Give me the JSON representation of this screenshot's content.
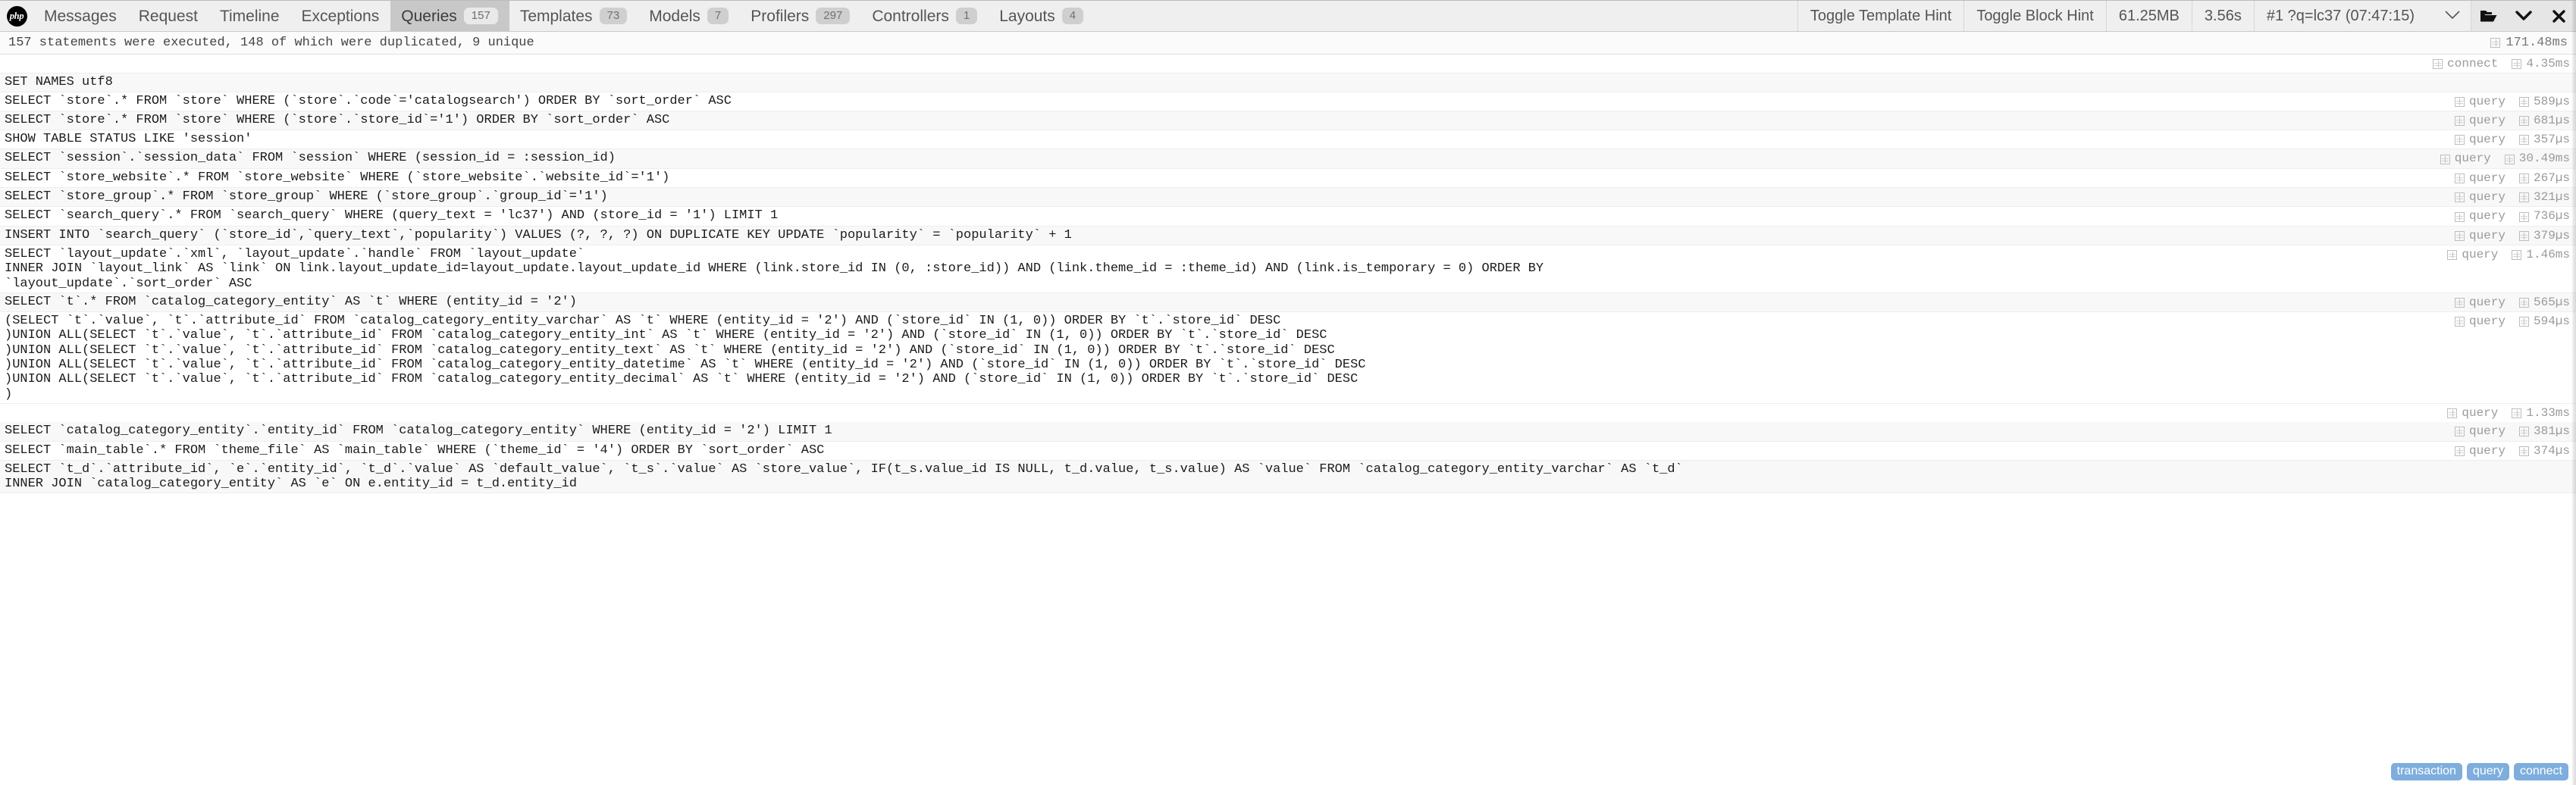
{
  "header": {
    "logo": "php-logo",
    "tabs": [
      {
        "label": "Messages",
        "badge": null,
        "active": false,
        "name": "tab-messages"
      },
      {
        "label": "Request",
        "badge": null,
        "active": false,
        "name": "tab-request"
      },
      {
        "label": "Timeline",
        "badge": null,
        "active": false,
        "name": "tab-timeline"
      },
      {
        "label": "Exceptions",
        "badge": null,
        "active": false,
        "name": "tab-exceptions"
      },
      {
        "label": "Queries",
        "badge": "157",
        "active": true,
        "name": "tab-queries"
      },
      {
        "label": "Templates",
        "badge": "73",
        "active": false,
        "name": "tab-templates"
      },
      {
        "label": "Models",
        "badge": "7",
        "active": false,
        "name": "tab-models"
      },
      {
        "label": "Profilers",
        "badge": "297",
        "active": false,
        "name": "tab-profilers"
      },
      {
        "label": "Controllers",
        "badge": "1",
        "active": false,
        "name": "tab-controllers"
      },
      {
        "label": "Layouts",
        "badge": "4",
        "active": false,
        "name": "tab-layouts"
      }
    ],
    "toggle_template_hint": "Toggle Template Hint",
    "toggle_block_hint": "Toggle Block Hint",
    "memory": "61.25MB",
    "time": "3.56s",
    "dataset": "#1 ?q=lc37 (07:47:15)",
    "controls": {
      "open_icon": "open-folder-icon",
      "minimize_icon": "chevron-down-icon",
      "close_icon": "close-icon",
      "dataset_chevron": "chevron-down-icon"
    }
  },
  "summary": {
    "text": "157 statements were executed, 148 of which were duplicated, 9 unique",
    "total_time": "171.48ms",
    "total_time_icon": "duration-icon"
  },
  "queries": [
    {
      "sql": "SET NAMES utf8",
      "type": "",
      "duration": "",
      "has_meta": false
    },
    {
      "sql": "SELECT `store`.* FROM `store` WHERE (`store`.`code`='catalogsearch') ORDER BY `sort_order` ASC",
      "type": "query",
      "duration": "589µs",
      "has_meta": true
    },
    {
      "sql": "SELECT `store`.* FROM `store` WHERE (`store`.`store_id`='1') ORDER BY `sort_order` ASC",
      "type": "query",
      "duration": "681µs",
      "has_meta": true
    },
    {
      "sql": "SHOW TABLE STATUS LIKE 'session'",
      "type": "query",
      "duration": "357µs",
      "has_meta": true
    },
    {
      "sql": "SELECT `session`.`session_data` FROM `session` WHERE (session_id = :session_id)",
      "type": "query",
      "duration": "30.49ms",
      "has_meta": true
    },
    {
      "sql": "SELECT `store_website`.* FROM `store_website` WHERE (`store_website`.`website_id`='1')",
      "type": "query",
      "duration": "267µs",
      "has_meta": true
    },
    {
      "sql": "SELECT `store_group`.* FROM `store_group` WHERE (`store_group`.`group_id`='1')",
      "type": "query",
      "duration": "321µs",
      "has_meta": true
    },
    {
      "sql": "SELECT `search_query`.* FROM `search_query` WHERE (query_text = 'lc37') AND (store_id = '1') LIMIT 1",
      "type": "query",
      "duration": "736µs",
      "has_meta": true
    },
    {
      "sql": "INSERT INTO `search_query` (`store_id`,`query_text`,`popularity`) VALUES (?, ?, ?) ON DUPLICATE KEY UPDATE `popularity` = `popularity` + 1",
      "type": "query",
      "duration": "379µs",
      "has_meta": true
    },
    {
      "sql": "SELECT `layout_update`.`xml`, `layout_update`.`handle` FROM `layout_update`\nINNER JOIN `layout_link` AS `link` ON link.layout_update_id=layout_update.layout_update_id WHERE (link.store_id IN (0, :store_id)) AND (link.theme_id = :theme_id) AND (link.is_temporary = 0) ORDER BY\n`layout_update`.`sort_order` ASC",
      "type": "query",
      "duration": "1.46ms",
      "has_meta": true
    },
    {
      "sql": "SELECT `t`.* FROM `catalog_category_entity` AS `t` WHERE (entity_id = '2')",
      "type": "query",
      "duration": "565µs",
      "has_meta": true
    },
    {
      "sql": "(SELECT `t`.`value`, `t`.`attribute_id` FROM `catalog_category_entity_varchar` AS `t` WHERE (entity_id = '2') AND (`store_id` IN (1, 0)) ORDER BY `t`.`store_id` DESC\n)UNION ALL(SELECT `t`.`value`, `t`.`attribute_id` FROM `catalog_category_entity_int` AS `t` WHERE (entity_id = '2') AND (`store_id` IN (1, 0)) ORDER BY `t`.`store_id` DESC\n)UNION ALL(SELECT `t`.`value`, `t`.`attribute_id` FROM `catalog_category_entity_text` AS `t` WHERE (entity_id = '2') AND (`store_id` IN (1, 0)) ORDER BY `t`.`store_id` DESC\n)UNION ALL(SELECT `t`.`value`, `t`.`attribute_id` FROM `catalog_category_entity_datetime` AS `t` WHERE (entity_id = '2') AND (`store_id` IN (1, 0)) ORDER BY `t`.`store_id` DESC\n)UNION ALL(SELECT `t`.`value`, `t`.`attribute_id` FROM `catalog_category_entity_decimal` AS `t` WHERE (entity_id = '2') AND (`store_id` IN (1, 0)) ORDER BY `t`.`store_id` DESC\n)",
      "type": "query",
      "duration": "594µs",
      "has_meta": true,
      "meta_bottom": true,
      "meta_extra": "1.33ms"
    },
    {
      "sql": "SELECT `catalog_category_entity`.`entity_id` FROM `catalog_category_entity` WHERE (entity_id = '2') LIMIT 1",
      "type": "query",
      "duration": "381µs",
      "has_meta": true
    },
    {
      "sql": "SELECT `main_table`.* FROM `theme_file` AS `main_table` WHERE (`theme_id` = '4') ORDER BY `sort_order` ASC",
      "type": "query",
      "duration": "374µs",
      "has_meta": true
    },
    {
      "sql": "SELECT `t_d`.`attribute_id`, `e`.`entity_id`, `t_d`.`value` AS `default_value`, `t_s`.`value` AS `store_value`, IF(t_s.value_id IS NULL, t_d.value, t_s.value) AS `value` FROM `catalog_category_entity_varchar` AS `t_d`\nINNER JOIN `catalog_category_entity` AS `e` ON e.entity_id = t_d.entity_id",
      "type": "query",
      "duration": "",
      "has_meta": false
    }
  ],
  "connect_row": {
    "type": "connect",
    "duration": "4.35ms"
  },
  "footer_badges": [
    {
      "label": "transaction",
      "name": "badge-transaction"
    },
    {
      "label": "query",
      "name": "badge-query"
    },
    {
      "label": "connect",
      "name": "badge-connect"
    }
  ],
  "colors": {
    "accent": "#7daedd",
    "header_bg": "#efefef",
    "active_tab_bg": "#c8c8c8",
    "row_alt_bg": "#f8f8f8"
  }
}
